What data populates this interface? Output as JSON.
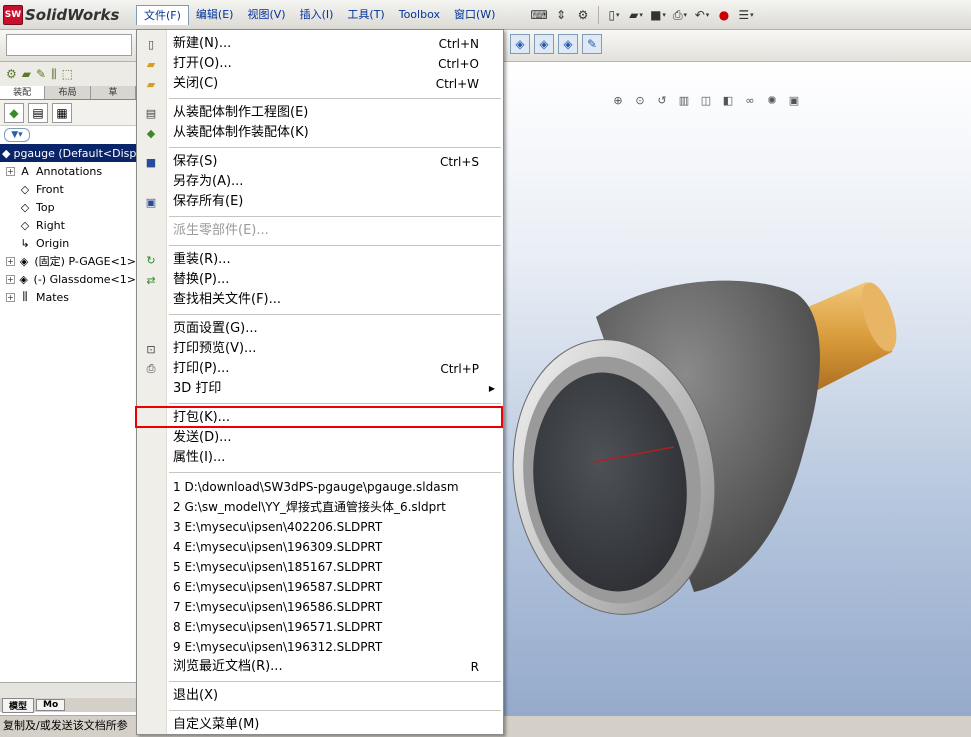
{
  "app": {
    "logo_text": "SolidWorks",
    "logo_badge": "SW"
  },
  "menubar": [
    "文件(F)",
    "编辑(E)",
    "视图(V)",
    "插入(I)",
    "工具(T)",
    "Toolbox",
    "窗口(W)"
  ],
  "left_panel": {
    "tabs": [
      "装配",
      "布局",
      "草"
    ],
    "tree": [
      {
        "label": "pgauge  (Default<Displ",
        "kind": "root",
        "icon": "assembly-icon"
      },
      {
        "label": "Annotations",
        "expand": "+",
        "icon": "annotation-icon"
      },
      {
        "label": "Front",
        "icon": "plane-icon"
      },
      {
        "label": "Top",
        "icon": "plane-icon"
      },
      {
        "label": "Right",
        "icon": "plane-icon"
      },
      {
        "label": "Origin",
        "icon": "origin-icon"
      },
      {
        "label": "(固定) P-GAGE<1>",
        "expand": "+",
        "icon": "part-icon"
      },
      {
        "label": "(-) Glassdome<1>",
        "expand": "+",
        "icon": "part-icon"
      },
      {
        "label": "Mates",
        "expand": "+",
        "icon": "mates-icon"
      }
    ],
    "bottom_tabs": [
      "模型",
      "Mo"
    ]
  },
  "status_bar": "复制及/或发送该文档所参",
  "file_menu": {
    "items": [
      {
        "label": "新建(N)...",
        "shortcut": "Ctrl+N",
        "icon": "new-doc-icon"
      },
      {
        "label": "打开(O)...",
        "shortcut": "Ctrl+O",
        "icon": "open-folder-icon"
      },
      {
        "label": "关闭(C)",
        "shortcut": "Ctrl+W",
        "icon": "close-folder-icon"
      },
      {
        "sep": true
      },
      {
        "label": "从装配体制作工程图(E)",
        "icon": "drawing-icon"
      },
      {
        "label": "从装配体制作装配体(K)",
        "icon": "assembly-icon"
      },
      {
        "sep": true
      },
      {
        "label": "保存(S)",
        "shortcut": "Ctrl+S",
        "icon": "save-icon"
      },
      {
        "label": "另存为(A)..."
      },
      {
        "label": "保存所有(E)",
        "icon": "save-all-icon"
      },
      {
        "sep": true
      },
      {
        "label": "派生零部件(E)...",
        "disabled": true
      },
      {
        "sep": true
      },
      {
        "label": "重装(R)...",
        "icon": "reload-icon"
      },
      {
        "label": "替换(P)...",
        "icon": "replace-icon"
      },
      {
        "label": "查找相关文件(F)..."
      },
      {
        "sep": true
      },
      {
        "label": "页面设置(G)..."
      },
      {
        "label": "打印预览(V)...",
        "icon": "print-preview-icon"
      },
      {
        "label": "打印(P)...",
        "shortcut": "Ctrl+P",
        "icon": "printer-icon"
      },
      {
        "label": "3D 打印",
        "submenu": true
      },
      {
        "sep": true
      },
      {
        "label": "打包(K)...",
        "highlighted": true
      },
      {
        "label": "发送(D)..."
      },
      {
        "label": "属性(I)..."
      },
      {
        "sep": true
      },
      {
        "label": "1 D:\\download\\SW3dPS-pgauge\\pgauge.sldasm"
      },
      {
        "label": "2 G:\\sw_model\\YY_焊接式直通管接头体_6.sldprt"
      },
      {
        "label": "3 E:\\mysecu\\ipsen\\402206.SLDPRT"
      },
      {
        "label": "4 E:\\mysecu\\ipsen\\196309.SLDPRT"
      },
      {
        "label": "5 E:\\mysecu\\ipsen\\185167.SLDPRT"
      },
      {
        "label": "6 E:\\mysecu\\ipsen\\196587.SLDPRT"
      },
      {
        "label": "7 E:\\mysecu\\ipsen\\196586.SLDPRT"
      },
      {
        "label": "8 E:\\mysecu\\ipsen\\196571.SLDPRT"
      },
      {
        "label": "9 E:\\mysecu\\ipsen\\196312.SLDPRT"
      },
      {
        "label": "浏览最近文档(R)...",
        "shortcut": "R"
      },
      {
        "sep": true
      },
      {
        "label": "退出(X)"
      },
      {
        "sep": true
      },
      {
        "label": "自定义菜单(M)"
      }
    ]
  },
  "colors": {
    "highlight_border": "#e00000",
    "selection": "#0a246a",
    "body_gray": "#6b6b6b",
    "stem": "#e0a040"
  }
}
